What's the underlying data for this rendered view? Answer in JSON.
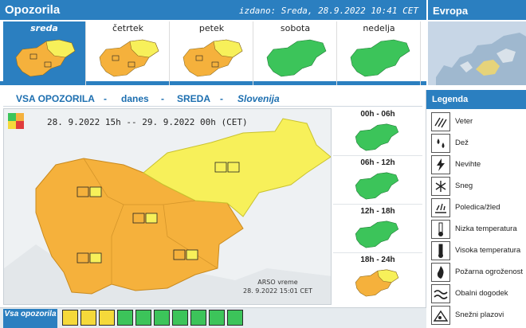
{
  "header": {
    "title": "Opozorila",
    "issued": "izdano: Sreda, 28.9.2022 10:41 CET",
    "europe_label": "Evropa"
  },
  "days": [
    {
      "label": "sreda",
      "level": "orange",
      "active": true
    },
    {
      "label": "četrtek",
      "level": "orange",
      "active": false
    },
    {
      "label": "petek",
      "level": "orange",
      "active": false
    },
    {
      "label": "sobota",
      "level": "green",
      "active": false
    },
    {
      "label": "nedelja",
      "level": "green",
      "active": false
    }
  ],
  "main": {
    "seg_all": "VSA OPOZORILA",
    "sep1": "-",
    "seg_today": "danes",
    "sep2": "-",
    "seg_day": "SREDA",
    "sep3": "-",
    "seg_region": "Slovenija",
    "range": "28. 9.2022 15h -- 29. 9.2022 00h   (CET)",
    "source_line1": "ARSO vreme",
    "source_line2": "28. 9.2022  15:01 CET"
  },
  "hours": [
    {
      "label": "00h - 06h",
      "level": "green"
    },
    {
      "label": "06h - 12h",
      "level": "green"
    },
    {
      "label": "12h - 18h",
      "level": "green"
    },
    {
      "label": "18h - 24h",
      "level": "orange"
    }
  ],
  "legend": {
    "title": "Legenda",
    "items": [
      {
        "label": "Veter",
        "icon": "wind-icon"
      },
      {
        "label": "Dež",
        "icon": "rain-icon"
      },
      {
        "label": "Nevihte",
        "icon": "thunderstorm-icon"
      },
      {
        "label": "Sneg",
        "icon": "snow-icon"
      },
      {
        "label": "Poledica/žled",
        "icon": "ice-icon"
      },
      {
        "label": "Nizka temperatura",
        "icon": "low-temperature-icon"
      },
      {
        "label": "Visoka temperatura",
        "icon": "high-temperature-icon"
      },
      {
        "label": "Požarna ogroženost",
        "icon": "fire-icon"
      },
      {
        "label": "Obalni dogodek",
        "icon": "coastal-icon"
      },
      {
        "label": "Snežni plazovi",
        "icon": "avalanche-icon"
      }
    ]
  },
  "bottom": {
    "label": "Vsa opozorila",
    "buttons": [
      "wind-icon",
      "rain-icon",
      "thunderstorm-icon",
      "snow-icon",
      "ice-icon",
      "low-temperature-icon",
      "high-temperature-icon",
      "fire-icon",
      "coastal-icon",
      "avalanche-icon"
    ]
  },
  "colors": {
    "brand": "#2b7fc0",
    "orange": "#f5b13c",
    "yellow": "#f7f05a",
    "green": "#3cc45a",
    "red": "#e03c3c"
  }
}
